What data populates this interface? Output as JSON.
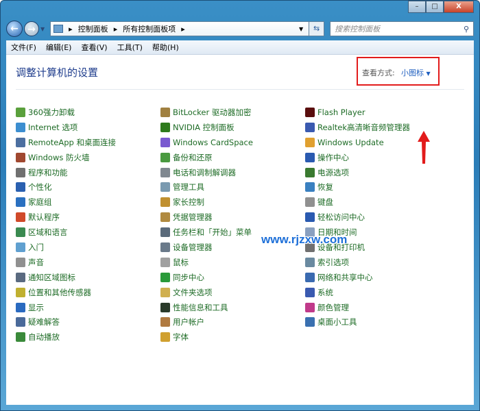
{
  "window": {
    "minimize": "–",
    "maximize": "□",
    "close": "X"
  },
  "nav": {
    "breadcrumb": [
      "控制面板",
      "所有控制面板项"
    ],
    "search_placeholder": "搜索控制面板"
  },
  "menu": [
    "文件(F)",
    "编辑(E)",
    "查看(V)",
    "工具(T)",
    "帮助(H)"
  ],
  "page": {
    "title": "调整计算机的设置",
    "view_by_label": "查看方式:",
    "view_by_value": "小图标"
  },
  "watermark": "www.rjzxw.com",
  "items": [
    {
      "label": "360强力卸载",
      "color": "#5aa03c"
    },
    {
      "label": "BitLocker 驱动器加密",
      "color": "#a08040"
    },
    {
      "label": "Flash Player",
      "color": "#5a0e0e"
    },
    {
      "label": "Internet 选项",
      "color": "#3c8ed0"
    },
    {
      "label": "NVIDIA 控制面板",
      "color": "#2e7a1c"
    },
    {
      "label": "Realtek高清晰音频管理器",
      "color": "#3a5ab0"
    },
    {
      "label": "RemoteApp 和桌面连接",
      "color": "#4c6fa0"
    },
    {
      "label": "Windows CardSpace",
      "color": "#7a5ad0"
    },
    {
      "label": "Windows Update",
      "color": "#e0a030"
    },
    {
      "label": "Windows 防火墙",
      "color": "#a04830"
    },
    {
      "label": "备份和还原",
      "color": "#4a9a40"
    },
    {
      "label": "操作中心",
      "color": "#2a5ab0"
    },
    {
      "label": "程序和功能",
      "color": "#707070"
    },
    {
      "label": "电话和调制解调器",
      "color": "#808890"
    },
    {
      "label": "电源选项",
      "color": "#3a7a30"
    },
    {
      "label": "个性化",
      "color": "#2a60b0"
    },
    {
      "label": "管理工具",
      "color": "#7a9ab0"
    },
    {
      "label": "恢复",
      "color": "#3a80c0"
    },
    {
      "label": "家庭组",
      "color": "#2a70c0"
    },
    {
      "label": "家长控制",
      "color": "#c09030"
    },
    {
      "label": "键盘",
      "color": "#909090"
    },
    {
      "label": "默认程序",
      "color": "#d04a2a"
    },
    {
      "label": "凭据管理器",
      "color": "#b08a40"
    },
    {
      "label": "轻松访问中心",
      "color": "#2a5ab0"
    },
    {
      "label": "区域和语言",
      "color": "#3a8a50"
    },
    {
      "label": "任务栏和「开始」菜单",
      "color": "#5a6a7a"
    },
    {
      "label": "日期和时间",
      "color": "#8aa0c0"
    },
    {
      "label": "入门",
      "color": "#60a0d0"
    },
    {
      "label": "设备管理器",
      "color": "#6a7a8a"
    },
    {
      "label": "设备和打印机",
      "color": "#707070"
    },
    {
      "label": "声音",
      "color": "#909090"
    },
    {
      "label": "鼠标",
      "color": "#a0a0a0"
    },
    {
      "label": "索引选项",
      "color": "#6a8aa0"
    },
    {
      "label": "通知区域图标",
      "color": "#5a6a80"
    },
    {
      "label": "同步中心",
      "color": "#2a9a3a"
    },
    {
      "label": "网络和共享中心",
      "color": "#3a6ab0"
    },
    {
      "label": "位置和其他传感器",
      "color": "#c0b030"
    },
    {
      "label": "文件夹选项",
      "color": "#d0b050"
    },
    {
      "label": "系统",
      "color": "#3a5ab0"
    },
    {
      "label": "显示",
      "color": "#2a6ac0"
    },
    {
      "label": "性能信息和工具",
      "color": "#2a3a2a"
    },
    {
      "label": "颜色管理",
      "color": "#c03a8a"
    },
    {
      "label": "疑难解答",
      "color": "#4a6a9a"
    },
    {
      "label": "用户帐户",
      "color": "#b07a40"
    },
    {
      "label": "桌面小工具",
      "color": "#3a70b0"
    },
    {
      "label": "自动播放",
      "color": "#3a8a3a"
    },
    {
      "label": "字体",
      "color": "#d0a030"
    }
  ]
}
